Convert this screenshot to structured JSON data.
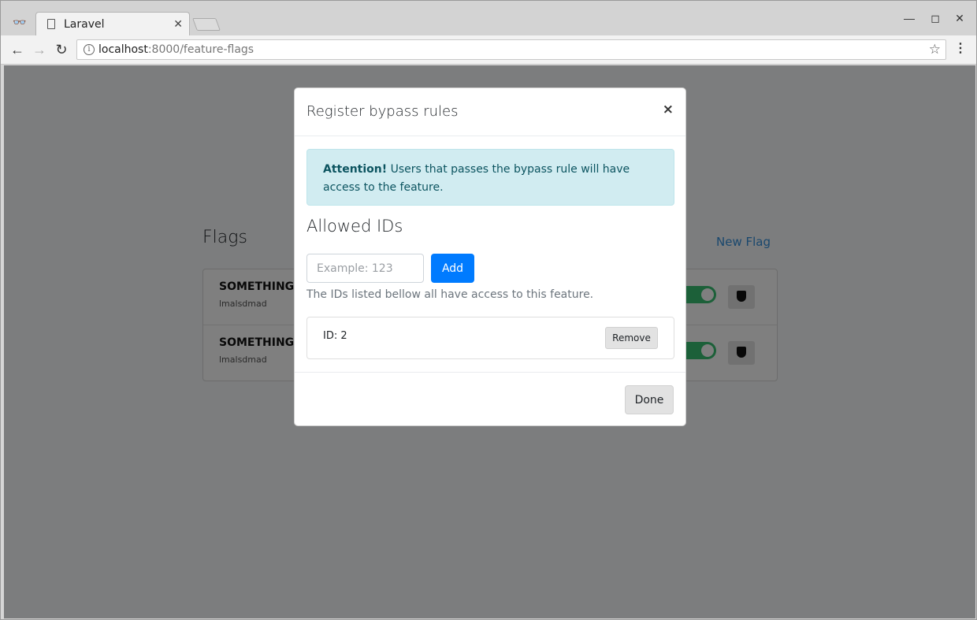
{
  "browser": {
    "tab_title": "Laravel",
    "tab_close": "✕",
    "url_host": "localhost",
    "url_rest": ":8000/feature-flags",
    "window_controls": [
      "—",
      "◻",
      "✕"
    ],
    "back": "←",
    "forward": "→",
    "reload": "↻",
    "star": "☆",
    "menu": "⋮"
  },
  "page": {
    "title": "Flags",
    "new_flag_label": "New Flag",
    "flags": [
      {
        "name": "SOMETHING",
        "description": "lmalsdmad",
        "enabled": true
      },
      {
        "name": "SOMETHING_I",
        "description": "lmalsdmad",
        "enabled": true
      }
    ]
  },
  "modal": {
    "title": "Register bypass rules",
    "close": "×",
    "alert_strong": "Attention!",
    "alert_text": " Users that passes the bypass rule will have access to the feature.",
    "allowed_title": "Allowed IDs",
    "input_placeholder": "Example: 123",
    "add_label": "Add",
    "help_text": "The IDs listed bellow all have access to this feature.",
    "ids": [
      {
        "label": "ID: 2",
        "remove_label": "Remove"
      }
    ],
    "done_label": "Done"
  },
  "colors": {
    "primary": "#007bff",
    "link": "#3490dc",
    "alert_bg": "#d1ecf1",
    "alert_text": "#0c5460",
    "toggle_on": "#38c172"
  }
}
